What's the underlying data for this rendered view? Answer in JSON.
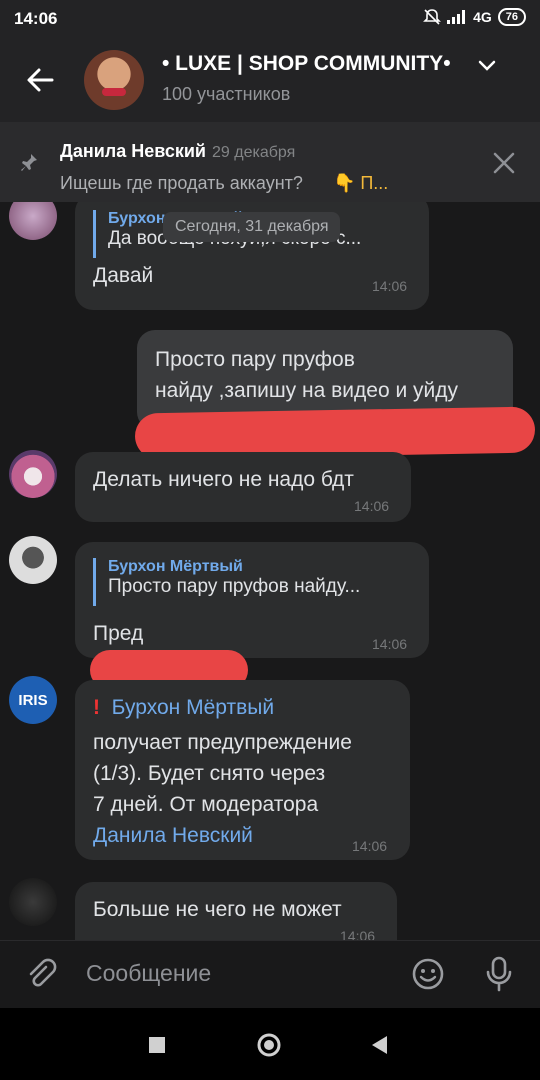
{
  "status_bar": {
    "time": "14:06",
    "network": "4G",
    "battery": "76"
  },
  "header": {
    "title": "• LUXE | SHOP COMMUNITY•",
    "subtitle": "100 участников"
  },
  "pinned": {
    "author": "Данила Невский",
    "date": "29 декабря",
    "text": "Ищешь где продать аккаунт?",
    "emoji": "👇 П..."
  },
  "date_divider": "Сегодня, 31 декабря",
  "messages": [
    {
      "reply_name": "Бурхон Мёртвый",
      "reply_text": "Да вообще похуй,я скоро с...",
      "text": "Давай",
      "time": "14:06"
    },
    {
      "text_line1": "Просто пару пруфов",
      "text_line2": "найду ,запишу на видео и уйду"
    },
    {
      "text": "Делать ничего не надо бдт",
      "time": "14:06"
    },
    {
      "reply_name": "Бурхон Мёртвый",
      "reply_text": "Просто пару пруфов найду...",
      "text": "Пред",
      "time": "14:06"
    },
    {
      "mention": "Бурхон Мёртвый",
      "line2": "получает предупреждение",
      "line3": "(1/3). Будет снято через",
      "line4": "7 дней. От модератора",
      "moderator": "Данила Невский",
      "time": "14:06",
      "iris_label": "IRIS"
    },
    {
      "text": "Больше не чего не может",
      "time": "14:06"
    }
  ],
  "input": {
    "placeholder": "Сообщение"
  }
}
